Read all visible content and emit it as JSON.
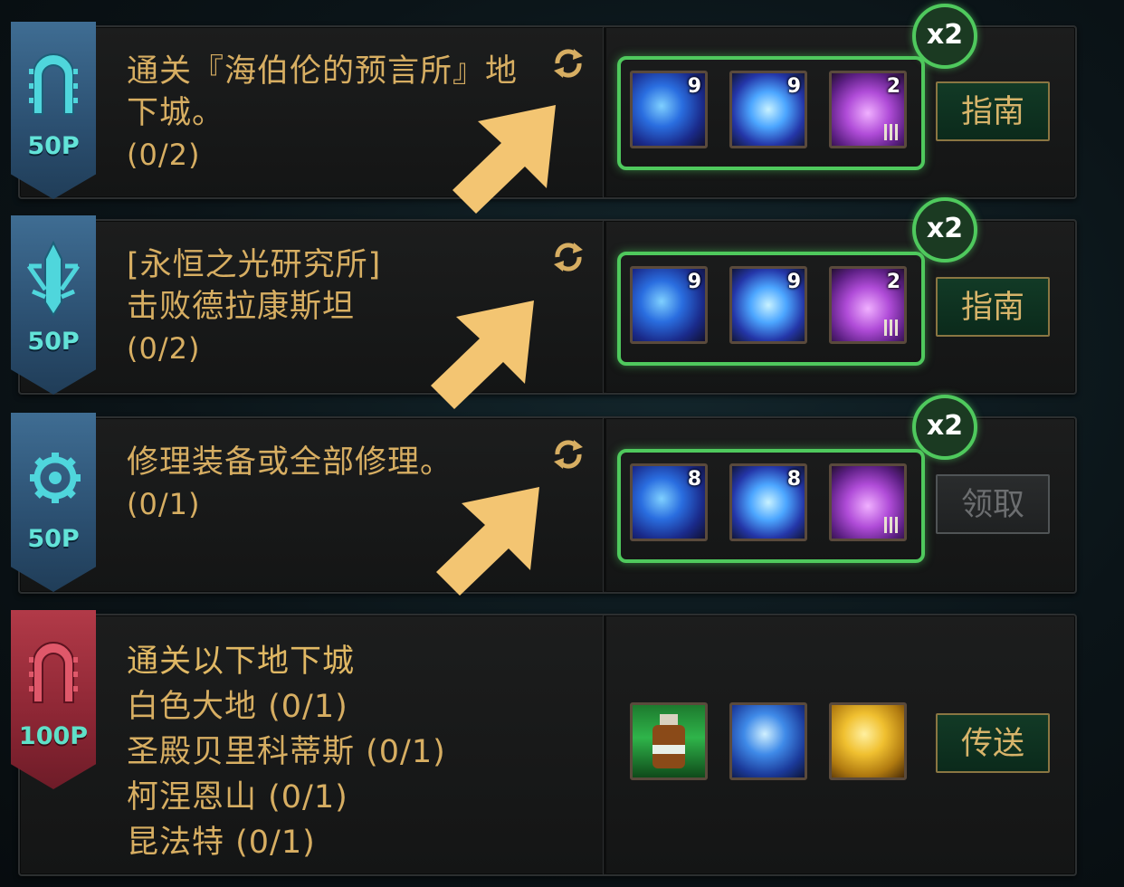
{
  "colors": {
    "gold_text": "#d7ae62",
    "green_frame": "#4fc95d",
    "points_text": "#62e3d8",
    "blue_banner": "#2b4f70",
    "red_banner": "#8c2634",
    "arrow": "#f3c572"
  },
  "quests": [
    {
      "points": "50P",
      "icon": "gate-icon",
      "lines": [
        "通关『海伯伦的预言所』地",
        "下城。",
        "(0/2)"
      ],
      "multiplier": "x2",
      "items": [
        {
          "icon": "blue-gem-icon",
          "count": "9"
        },
        {
          "icon": "blue-crystal-icon",
          "count": "9"
        },
        {
          "icon": "purple-chest-icon",
          "count": "2"
        }
      ],
      "button": "指南"
    },
    {
      "points": "50P",
      "icon": "sword-emblem-icon",
      "lines": [
        "[永恒之光研究所]",
        "击败德拉康斯坦",
        "(0/2)"
      ],
      "multiplier": "x2",
      "items": [
        {
          "icon": "blue-gem-icon",
          "count": "9"
        },
        {
          "icon": "blue-crystal-icon",
          "count": "9"
        },
        {
          "icon": "purple-chest-icon",
          "count": "2"
        }
      ],
      "button": "指南"
    },
    {
      "points": "50P",
      "icon": "gear-icon",
      "lines": [
        "修理装备或全部修理。",
        "(0/1)"
      ],
      "multiplier": "x2",
      "items": [
        {
          "icon": "blue-gem-icon",
          "count": "8"
        },
        {
          "icon": "blue-crystal-icon",
          "count": "8"
        },
        {
          "icon": "purple-chest-icon",
          "count": ""
        }
      ],
      "button": "领取"
    },
    {
      "points": "100P",
      "icon": "gate-icon",
      "lines": [
        "通关以下地下城",
        "白色大地 (0/1)",
        "圣殿贝里科蒂斯 (0/1)",
        "柯涅恩山 (0/1)",
        "昆法特 (0/1)"
      ],
      "items": [
        {
          "icon": "green-potion-icon",
          "count": ""
        },
        {
          "icon": "blue-orb-icon",
          "count": ""
        },
        {
          "icon": "gold-box-icon",
          "count": ""
        }
      ],
      "button": "传送"
    }
  ]
}
